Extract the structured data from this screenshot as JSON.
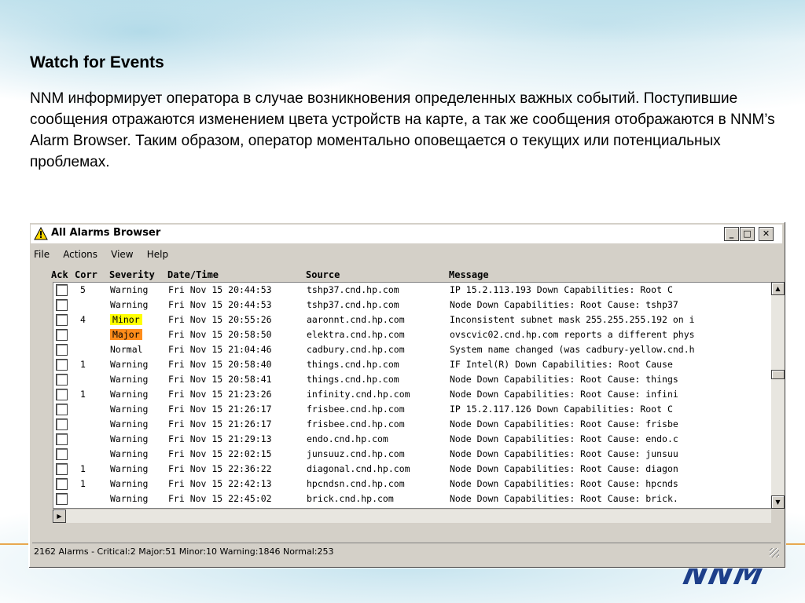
{
  "slide": {
    "title": "Watch for Events",
    "body": "NNM информирует оператора в случае возникновения определенных важных событий. Поступившие сообщения отражаются изменением цвета устройств на карте, а так же сообщения отображаются в NNM’s Alarm Browser. Таким образом, оператор моментально оповещается о текущих или потенциальных проблемах.",
    "logo": "NNM"
  },
  "window": {
    "title": "All Alarms Browser",
    "title_icon": "warning-triangle-icon",
    "buttons": {
      "minimize": "_",
      "maximize": "□",
      "close": "✕"
    },
    "menu": [
      "File",
      "Actions",
      "View",
      "Help"
    ]
  },
  "columns": [
    "Ack",
    "Corr",
    "Severity",
    "Date/Time",
    "Source",
    "Message"
  ],
  "rows": [
    {
      "corr": "5",
      "severity": "Warning",
      "datetime": "Fri Nov 15 20:44:53",
      "source": "tshp37.cnd.hp.com",
      "message": "IP 15.2.113.193 Down   Capabilities:   Root C"
    },
    {
      "corr": "",
      "severity": "Warning",
      "datetime": "Fri Nov 15 20:44:53",
      "source": "tshp37.cnd.hp.com",
      "message": "Node Down  Capabilities:   Root Cause: tshp37"
    },
    {
      "corr": "4",
      "severity": "Minor",
      "datetime": "Fri Nov 15 20:55:26",
      "source": "aaronnt.cnd.hp.com",
      "message": "Inconsistent subnet mask 255.255.255.192 on i"
    },
    {
      "corr": "",
      "severity": "Major",
      "datetime": "Fri Nov 15 20:58:50",
      "source": "elektra.cnd.hp.com",
      "message": "ovscvic02.cnd.hp.com reports a different phys"
    },
    {
      "corr": "",
      "severity": "Normal",
      "datetime": "Fri Nov 15 21:04:46",
      "source": "cadbury.cnd.hp.com",
      "message": "System name changed (was cadbury-yellow.cnd.h"
    },
    {
      "corr": "1",
      "severity": "Warning",
      "datetime": "Fri Nov 15 20:58:40",
      "source": "things.cnd.hp.com",
      "message": "IF Intel(R) Down   Capabilities:   Root Cause"
    },
    {
      "corr": "",
      "severity": "Warning",
      "datetime": "Fri Nov 15 20:58:41",
      "source": "things.cnd.hp.com",
      "message": "Node Down  Capabilities:   Root Cause: things"
    },
    {
      "corr": "1",
      "severity": "Warning",
      "datetime": "Fri Nov 15 21:23:26",
      "source": "infinity.cnd.hp.com",
      "message": "Node Down  Capabilities:   Root Cause: infini"
    },
    {
      "corr": "",
      "severity": "Warning",
      "datetime": "Fri Nov 15 21:26:17",
      "source": "frisbee.cnd.hp.com",
      "message": "IP 15.2.117.126 Down   Capabilities:   Root C"
    },
    {
      "corr": "",
      "severity": "Warning",
      "datetime": "Fri Nov 15 21:26:17",
      "source": "frisbee.cnd.hp.com",
      "message": "Node Down  Capabilities:   Root Cause: frisbe"
    },
    {
      "corr": "",
      "severity": "Warning",
      "datetime": "Fri Nov 15 21:29:13",
      "source": "endo.cnd.hp.com",
      "message": "Node Down  Capabilities:   Root Cause: endo.c"
    },
    {
      "corr": "",
      "severity": "Warning",
      "datetime": "Fri Nov 15 22:02:15",
      "source": "junsuuz.cnd.hp.com",
      "message": "Node Down  Capabilities:   Root Cause: junsuu"
    },
    {
      "corr": "1",
      "severity": "Warning",
      "datetime": "Fri Nov 15 22:36:22",
      "source": "diagonal.cnd.hp.com",
      "message": "Node Down  Capabilities:   Root Cause: diagon"
    },
    {
      "corr": "1",
      "severity": "Warning",
      "datetime": "Fri Nov 15 22:42:13",
      "source": "hpcndsn.cnd.hp.com",
      "message": "Node Down  Capabilities:   Root Cause: hpcnds"
    },
    {
      "corr": "",
      "severity": "Warning",
      "datetime": "Fri Nov 15 22:45:02",
      "source": "brick.cnd.hp.com",
      "message": "Node Down  Capabilities:   Root Cause: brick."
    }
  ],
  "severity_colors": {
    "Minor": "#ffff00",
    "Major": "#ff8c1a"
  },
  "status": "2162 Alarms -  Critical:2  Major:51  Minor:10  Warning:1846  Normal:253"
}
